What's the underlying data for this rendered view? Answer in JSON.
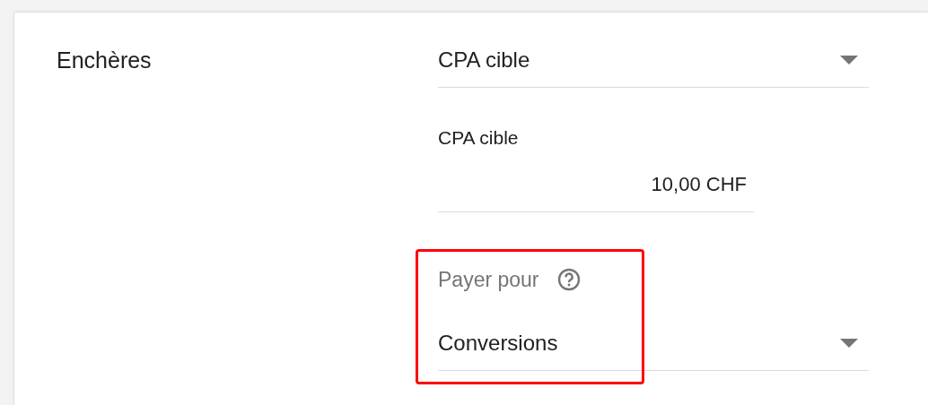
{
  "bidding": {
    "label": "Enchères",
    "strategy": {
      "value": "CPA cible"
    },
    "target_cpa": {
      "label": "CPA cible",
      "value": "10,00 CHF"
    },
    "pay_for": {
      "label": "Payer pour",
      "value": "Conversions",
      "highlighted": true
    }
  }
}
